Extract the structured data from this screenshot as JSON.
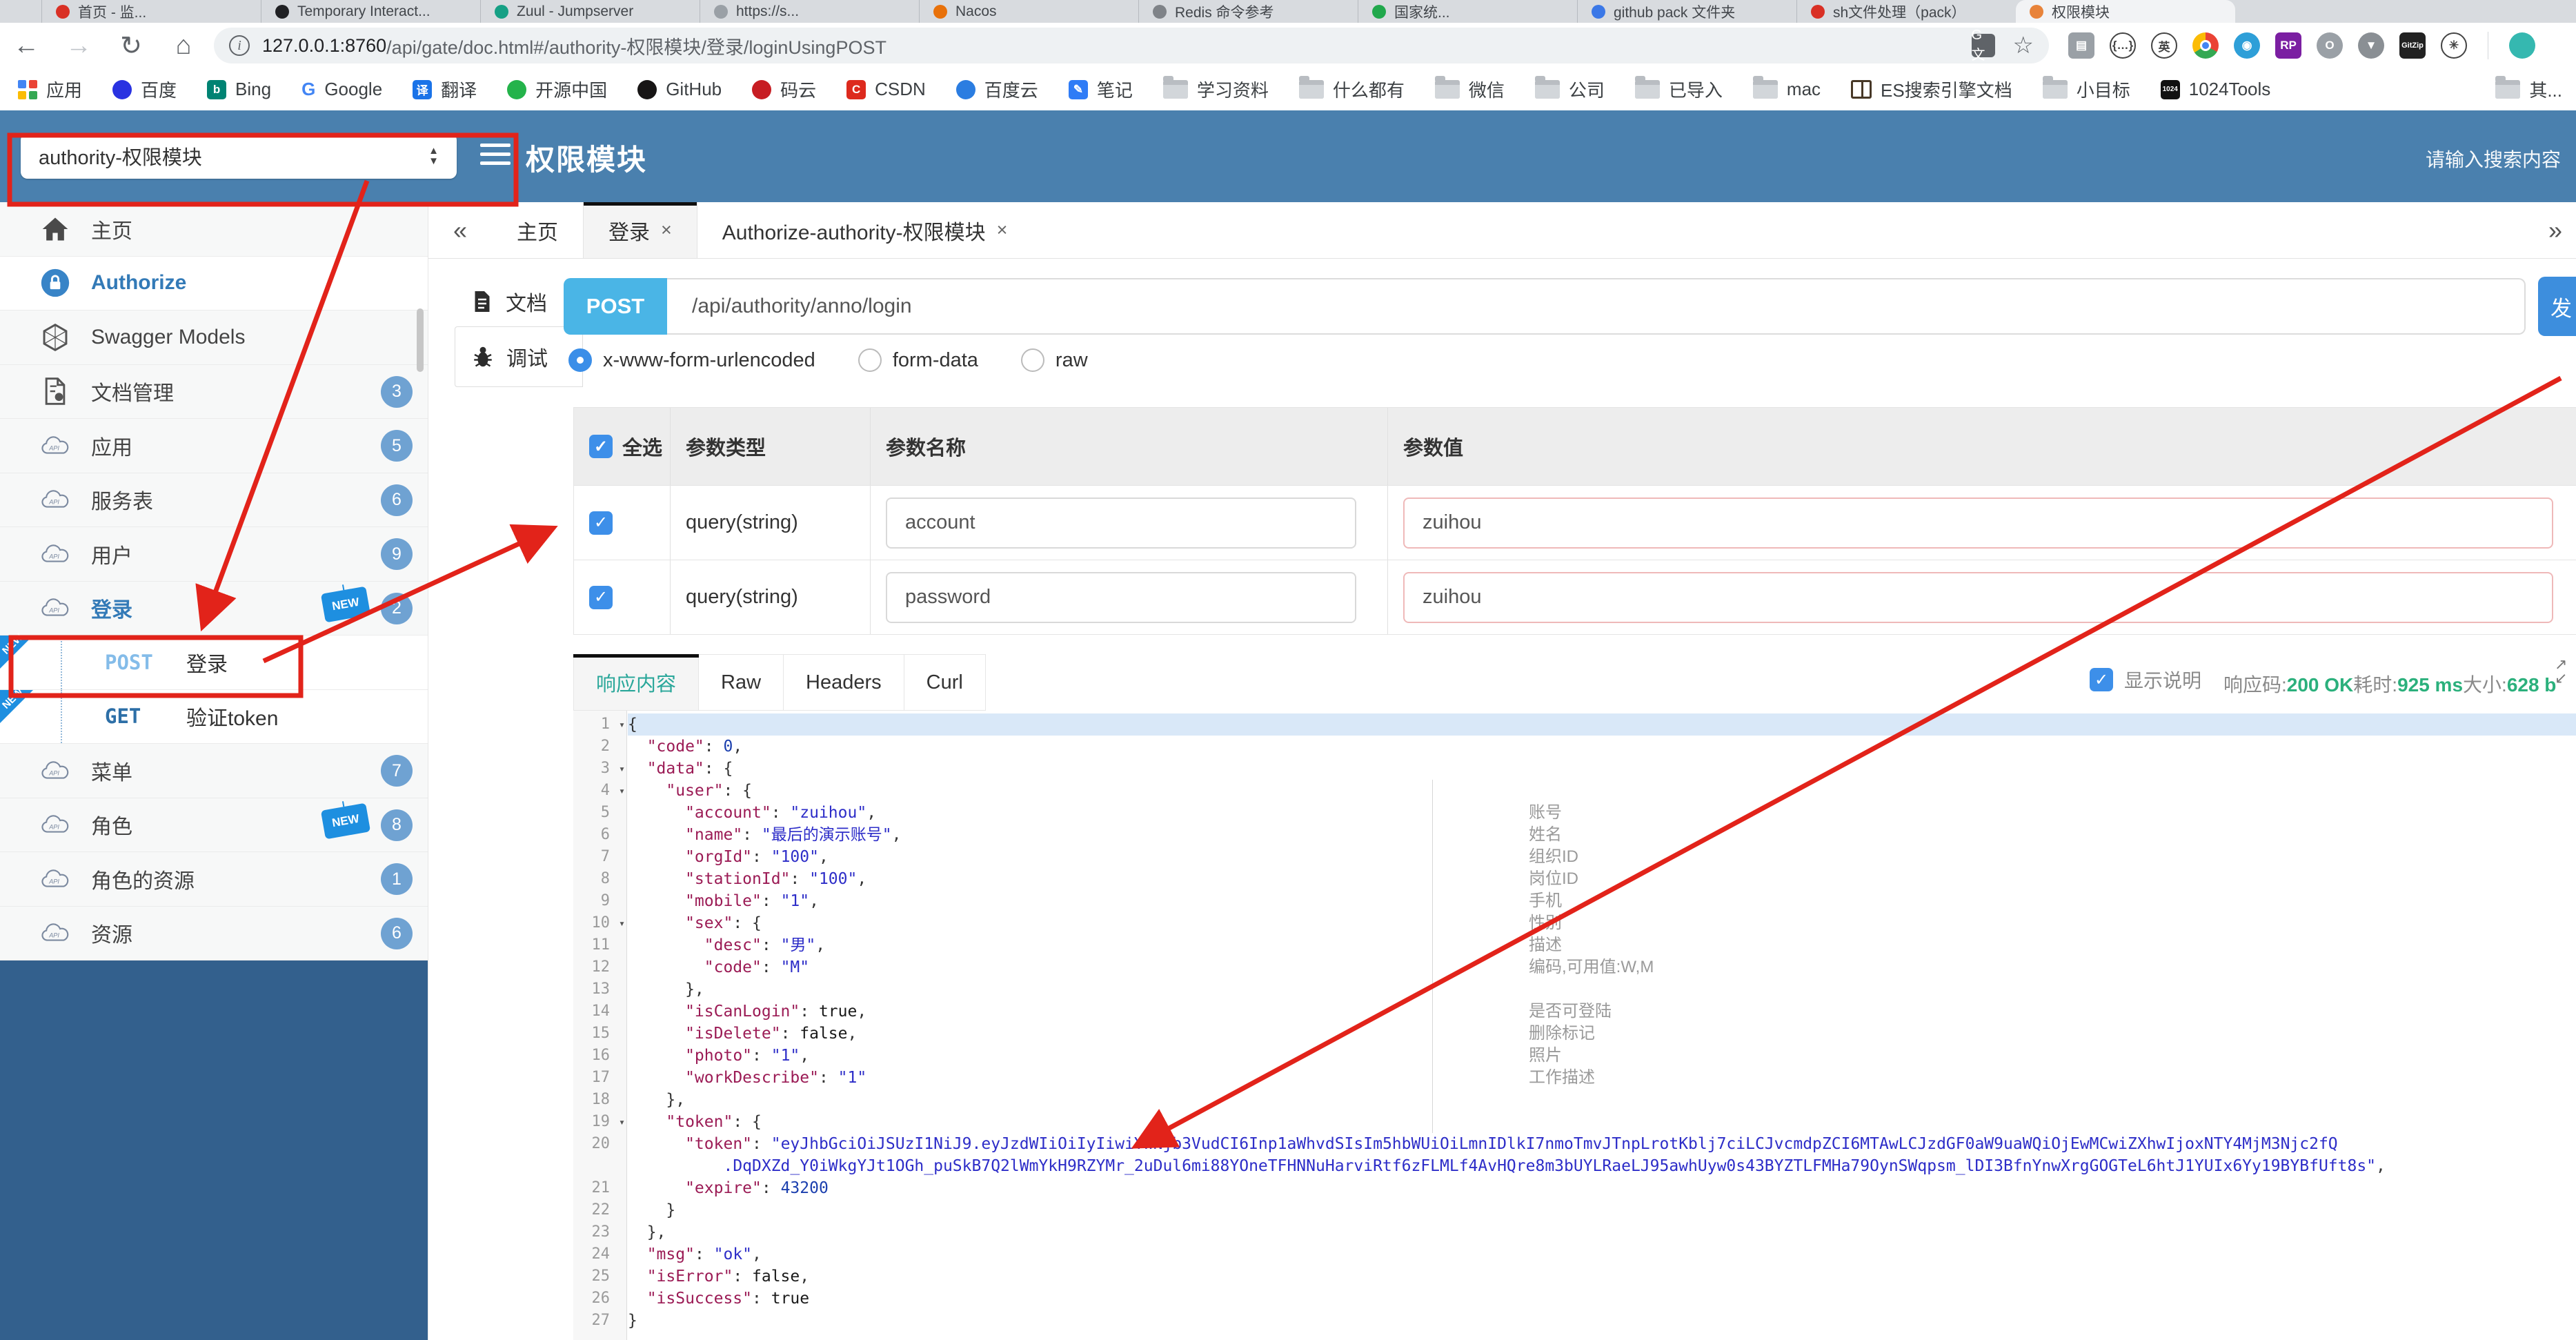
{
  "icons": {
    "back": "←",
    "forward": "→",
    "reload": "↻",
    "home": "⌂",
    "star": "☆",
    "info": "i",
    "chev_left": "«",
    "chev_right": "»",
    "close": "×",
    "fold": "▾",
    "expand_ne": "↗",
    "expand_sw": "↙",
    "check": "✓",
    "select_up": "▲",
    "select_down": "▼"
  },
  "browser": {
    "tab_strip": {
      "tabs": [
        {
          "label": "首页 - 监...",
          "color": "#d93025"
        },
        {
          "label": "Temporary Interact...",
          "color": "#202124"
        },
        {
          "label": "Zuul - Jumpserver",
          "color": "#16a085"
        },
        {
          "label": "https://s...",
          "color": "#9aa0a6"
        },
        {
          "label": "Nacos",
          "color": "#e8710a"
        },
        {
          "label": "Redis 命令参考",
          "color": "#7f8388"
        },
        {
          "label": "国家统...",
          "color": "#21a84c"
        },
        {
          "label": "github pack 文件夹",
          "color": "#3b78e7"
        },
        {
          "label": "sh文件处理（pack）",
          "color": "#d93025"
        },
        {
          "label": "权限模块",
          "color": "#e8833a",
          "active": true
        }
      ]
    },
    "nav": {
      "url_host": "127.0.0.1:8760",
      "url_path": "/api/gate/doc.html#/authority-权限模块/登录/loginUsingPOST",
      "extensions": [
        {
          "name": "reader-extension-icon",
          "glyph": "▤",
          "color": "#9aa0a6",
          "shape": "sq"
        },
        {
          "name": "json-viewer-extension-icon",
          "glyph": "{…}",
          "outline": true
        },
        {
          "name": "translate-en-extension-icon",
          "glyph": "英",
          "color": "#3c4043",
          "outline": true
        },
        {
          "name": "chrome-extension-icon",
          "glyph": "",
          "color": "chrome"
        },
        {
          "name": "web-globe-extension-icon",
          "glyph": "◉",
          "color": "#2e9fd8"
        },
        {
          "name": "rp-extension-icon",
          "glyph": "RP",
          "color": "#7b1fa2",
          "shape": "sq"
        },
        {
          "name": "circle-o-extension-icon",
          "glyph": "O",
          "color": "#9aa0a6"
        },
        {
          "name": "chevron-m-extension-icon",
          "glyph": "▼",
          "color": "#8a8f94"
        },
        {
          "name": "gitzip-extension-icon",
          "glyph": "GitZip",
          "color": "#222",
          "shape": "sq"
        },
        {
          "name": "asterisk-extension-icon",
          "glyph": "✳",
          "color": "#7c4dff",
          "outline": true
        },
        {
          "name": "profile-avatar-icon",
          "glyph": "",
          "color": "#35b8b0"
        }
      ]
    },
    "bookmarks": [
      {
        "label": "应用",
        "type": "grid"
      },
      {
        "label": "百度",
        "type": "dot",
        "color": "#2932e1"
      },
      {
        "label": "Bing",
        "type": "sq",
        "color": "#008373",
        "glyph": "b"
      },
      {
        "label": "Google",
        "type": "letter",
        "color": "#4285f4",
        "glyph": "G"
      },
      {
        "label": "翻译",
        "type": "sq",
        "color": "#1a73e8",
        "glyph": "译"
      },
      {
        "label": "开源中国",
        "type": "dot",
        "color": "#24b34b"
      },
      {
        "label": "GitHub",
        "type": "dot",
        "color": "#171515"
      },
      {
        "label": "码云",
        "type": "dot",
        "color": "#c71d23",
        "glyph": "G"
      },
      {
        "label": "CSDN",
        "type": "sq",
        "color": "#dd2a1d",
        "glyph": "C"
      },
      {
        "label": "百度云",
        "type": "dot",
        "color": "#2b7de1"
      },
      {
        "label": "笔记",
        "type": "sq",
        "color": "#2f7cf6",
        "glyph": "✎"
      },
      {
        "label": "学习资料",
        "type": "folder"
      },
      {
        "label": "什么都有",
        "type": "folder"
      },
      {
        "label": "微信",
        "type": "folder"
      },
      {
        "label": "公司",
        "type": "folder"
      },
      {
        "label": "已导入",
        "type": "folder"
      },
      {
        "label": "mac",
        "type": "folder"
      },
      {
        "label": "ES搜索引擎文档",
        "type": "book"
      },
      {
        "label": "小目标",
        "type": "folder"
      },
      {
        "label": "1024Tools",
        "type": "sq",
        "color": "#111",
        "glyph": "1024"
      }
    ],
    "bookmarks_far": {
      "label": "其...",
      "type": "folder"
    }
  },
  "header": {
    "module_select": "authority-权限模块",
    "title": "权限模块",
    "search_placeholder": "请输入搜索内容"
  },
  "sidebar": {
    "new_label": "NEW",
    "items": [
      {
        "label": "主页",
        "icon": "home"
      },
      {
        "label": "Authorize",
        "icon": "lock",
        "highlight": true,
        "white": true
      },
      {
        "label": "Swagger Models",
        "icon": "hexagon"
      },
      {
        "label": "文档管理",
        "icon": "docgear",
        "badge": "3"
      },
      {
        "label": "应用",
        "icon": "cloud",
        "badge": "5"
      },
      {
        "label": "服务表",
        "icon": "cloud",
        "badge": "6"
      },
      {
        "label": "用户",
        "icon": "cloud",
        "badge": "9"
      },
      {
        "label": "登录",
        "icon": "cloud",
        "badge": "2",
        "new": true,
        "highlight": true
      },
      {
        "type": "sub",
        "method": "POST",
        "label": "登录",
        "new_ribbon": true
      },
      {
        "type": "sub",
        "method": "GET",
        "label": "验证token",
        "new_ribbon": true
      },
      {
        "label": "菜单",
        "icon": "cloud",
        "badge": "7"
      },
      {
        "label": "角色",
        "icon": "cloud",
        "badge": "8",
        "new": true
      },
      {
        "label": "角色的资源",
        "icon": "cloud",
        "badge": "1"
      },
      {
        "label": "资源",
        "icon": "cloud",
        "badge": "6"
      }
    ]
  },
  "content": {
    "nav_tabs": [
      {
        "label": "主页"
      },
      {
        "label": "登录",
        "closable": true,
        "active": true
      },
      {
        "label": "Authorize-authority-权限模块",
        "closable": true
      }
    ],
    "doc_tabs": [
      {
        "label": "文档",
        "icon": "doc"
      },
      {
        "label": "调试",
        "icon": "bug",
        "active": true
      }
    ],
    "request": {
      "method": "POST",
      "url": "/api/authority/anno/login",
      "send_label": "发"
    },
    "body_types": [
      {
        "label": "x-www-form-urlencoded",
        "selected": true
      },
      {
        "label": "form-data"
      },
      {
        "label": "raw"
      }
    ],
    "params_table": {
      "headers": [
        "全选",
        "参数类型",
        "参数名称",
        "参数值"
      ],
      "rows": [
        {
          "checked": true,
          "type": "query(string)",
          "name": "account",
          "value": "zuihou"
        },
        {
          "checked": true,
          "type": "query(string)",
          "name": "password",
          "value": "zuihou"
        }
      ]
    }
  },
  "response": {
    "tabs": [
      {
        "label": "响应内容",
        "active": true
      },
      {
        "label": "Raw"
      },
      {
        "label": "Headers"
      },
      {
        "label": "Curl"
      }
    ],
    "show_desc_label": "显示说明",
    "show_desc_checked": true,
    "status": [
      {
        "label": "响应码:",
        "value": "200 OK"
      },
      {
        "label": "耗时:",
        "value": "925 ms"
      },
      {
        "label": "大小:",
        "value": "628 b"
      }
    ]
  },
  "editor": {
    "lines": [
      {
        "n": 1,
        "fold": true,
        "hl": true,
        "ind": 0,
        "segs": [
          [
            "p",
            "{"
          ]
        ]
      },
      {
        "n": 2,
        "ind": 2,
        "segs": [
          [
            "k",
            "\"code\""
          ],
          [
            "p",
            ": "
          ],
          [
            "n",
            "0"
          ],
          [
            "p",
            ","
          ]
        ]
      },
      {
        "n": 3,
        "fold": true,
        "ind": 2,
        "segs": [
          [
            "k",
            "\"data\""
          ],
          [
            "p",
            ": {"
          ]
        ]
      },
      {
        "n": 4,
        "fold": true,
        "ind": 4,
        "segs": [
          [
            "k",
            "\"user\""
          ],
          [
            "p",
            ": {"
          ]
        ]
      },
      {
        "n": 5,
        "ind": 6,
        "segs": [
          [
            "k",
            "\"account\""
          ],
          [
            "p",
            ": "
          ],
          [
            "s",
            "\"zuihou\""
          ],
          [
            "p",
            ","
          ]
        ]
      },
      {
        "n": 6,
        "ind": 6,
        "segs": [
          [
            "k",
            "\"name\""
          ],
          [
            "p",
            ": "
          ],
          [
            "s",
            "\"最后的演示账号\""
          ],
          [
            "p",
            ","
          ]
        ]
      },
      {
        "n": 7,
        "ind": 6,
        "segs": [
          [
            "k",
            "\"orgId\""
          ],
          [
            "p",
            ": "
          ],
          [
            "s",
            "\"100\""
          ],
          [
            "p",
            ","
          ]
        ]
      },
      {
        "n": 8,
        "ind": 6,
        "segs": [
          [
            "k",
            "\"stationId\""
          ],
          [
            "p",
            ": "
          ],
          [
            "s",
            "\"100\""
          ],
          [
            "p",
            ","
          ]
        ]
      },
      {
        "n": 9,
        "ind": 6,
        "segs": [
          [
            "k",
            "\"mobile\""
          ],
          [
            "p",
            ": "
          ],
          [
            "s",
            "\"1\""
          ],
          [
            "p",
            ","
          ]
        ]
      },
      {
        "n": 10,
        "fold": true,
        "ind": 6,
        "segs": [
          [
            "k",
            "\"sex\""
          ],
          [
            "p",
            ": {"
          ]
        ]
      },
      {
        "n": 11,
        "ind": 8,
        "segs": [
          [
            "k",
            "\"desc\""
          ],
          [
            "p",
            ": "
          ],
          [
            "s",
            "\"男\""
          ],
          [
            "p",
            ","
          ]
        ]
      },
      {
        "n": 12,
        "ind": 8,
        "segs": [
          [
            "k",
            "\"code\""
          ],
          [
            "p",
            ": "
          ],
          [
            "s",
            "\"M\""
          ]
        ]
      },
      {
        "n": 13,
        "ind": 6,
        "segs": [
          [
            "p",
            "},"
          ]
        ]
      },
      {
        "n": 14,
        "ind": 6,
        "segs": [
          [
            "k",
            "\"isCanLogin\""
          ],
          [
            "p",
            ": "
          ],
          [
            "b",
            "true"
          ],
          [
            "p",
            ","
          ]
        ]
      },
      {
        "n": 15,
        "ind": 6,
        "segs": [
          [
            "k",
            "\"isDelete\""
          ],
          [
            "p",
            ": "
          ],
          [
            "b",
            "false"
          ],
          [
            "p",
            ","
          ]
        ]
      },
      {
        "n": 16,
        "ind": 6,
        "segs": [
          [
            "k",
            "\"photo\""
          ],
          [
            "p",
            ": "
          ],
          [
            "s",
            "\"1\""
          ],
          [
            "p",
            ","
          ]
        ]
      },
      {
        "n": 17,
        "ind": 6,
        "segs": [
          [
            "k",
            "\"workDescribe\""
          ],
          [
            "p",
            ": "
          ],
          [
            "s",
            "\"1\""
          ]
        ]
      },
      {
        "n": 18,
        "ind": 4,
        "segs": [
          [
            "p",
            "},"
          ]
        ]
      },
      {
        "n": 19,
        "fold": true,
        "ind": 4,
        "segs": [
          [
            "k",
            "\"token\""
          ],
          [
            "p",
            ": {"
          ]
        ]
      },
      {
        "n": 20,
        "ind": 6,
        "segs": [
          [
            "k",
            "\"token\""
          ],
          [
            "p",
            ": "
          ],
          [
            "s",
            "\"eyJhbGciOiJSUzI1NiJ9.eyJzdWIiOiIyIiwiYWNjb3VudCI6Inp1aWhvdSIsIm5hbWUiOiLmnIDlkI7nmoTmvJTnpLrotKblj7ciLCJvcmdpZCI6MTAwLCJzdGF0aW9uaWQiOjEwMCwiZXhwIjoxNTY4MjM3Njc2fQ"
          ]
        ]
      },
      {
        "ind": 10,
        "segs": [
          [
            "s",
            ".DqDXZd_Y0iWkgYJt1OGh_puSkB7Q2lWmYkH9RZYMr_2uDul6mi88YOneTFHNNuHarviRtf6zFLMLf4AvHQre8m3bUYLRaeLJ95awhUyw0s43BYZTLFMHa79OynSWqpsm_lDI3BfnYnwXrgGOGTeL6htJ1YUIx6Yy19BYBfUft8s\""
          ],
          [
            "p",
            ","
          ]
        ]
      },
      {
        "n": 21,
        "ind": 6,
        "segs": [
          [
            "k",
            "\"expire\""
          ],
          [
            "p",
            ": "
          ],
          [
            "n",
            "43200"
          ]
        ]
      },
      {
        "n": 22,
        "ind": 4,
        "segs": [
          [
            "p",
            "}"
          ]
        ]
      },
      {
        "n": 23,
        "ind": 2,
        "segs": [
          [
            "p",
            "},"
          ]
        ]
      },
      {
        "n": 24,
        "ind": 2,
        "segs": [
          [
            "k",
            "\"msg\""
          ],
          [
            "p",
            ": "
          ],
          [
            "s",
            "\"ok\""
          ],
          [
            "p",
            ","
          ]
        ]
      },
      {
        "n": 25,
        "ind": 2,
        "segs": [
          [
            "k",
            "\"isError\""
          ],
          [
            "p",
            ": "
          ],
          [
            "b",
            "false"
          ],
          [
            "p",
            ","
          ]
        ]
      },
      {
        "n": 26,
        "ind": 2,
        "segs": [
          [
            "k",
            "\"isSuccess\""
          ],
          [
            "p",
            ": "
          ],
          [
            "b",
            "true"
          ]
        ]
      },
      {
        "n": 27,
        "ind": 0,
        "segs": [
          [
            "p",
            "}"
          ]
        ]
      }
    ],
    "annotations": [
      {
        "line": 5,
        "text": "账号"
      },
      {
        "line": 6,
        "text": "姓名"
      },
      {
        "line": 7,
        "text": "组织ID"
      },
      {
        "line": 8,
        "text": "岗位ID"
      },
      {
        "line": 9,
        "text": "手机"
      },
      {
        "line": 10,
        "text": "性别"
      },
      {
        "line": 11,
        "text": "描述"
      },
      {
        "line": 12,
        "text": "编码,可用值:W,M"
      },
      {
        "line": 14,
        "text": "是否可登陆"
      },
      {
        "line": 15,
        "text": "删除标记"
      },
      {
        "line": 16,
        "text": "照片"
      },
      {
        "line": 17,
        "text": "工作描述"
      }
    ]
  }
}
